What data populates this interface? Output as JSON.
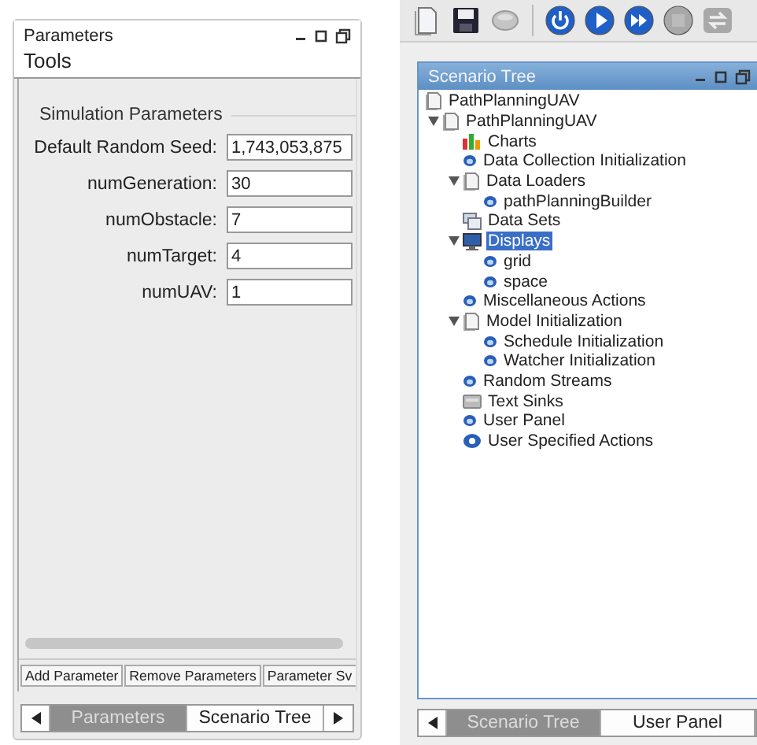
{
  "parameters_panel": {
    "title": "Parameters",
    "subtitle": "Tools",
    "group": {
      "title": "Simulation Parameters",
      "fields": [
        {
          "label": "Default Random Seed:",
          "value": "1,743,053,875"
        },
        {
          "label": "numGeneration:",
          "value": "30"
        },
        {
          "label": "numObstacle:",
          "value": "7"
        },
        {
          "label": "numTarget:",
          "value": "4"
        },
        {
          "label": "numUAV:",
          "value": "1"
        }
      ]
    },
    "buttons": [
      "Add Parameter",
      "Remove Parameters",
      "Parameter Sv"
    ],
    "tabs": [
      {
        "label": "Parameters",
        "selected": true
      },
      {
        "label": "Scenario Tree",
        "selected": false
      }
    ]
  },
  "toolbar": {
    "buttons": [
      {
        "kind": "document",
        "disabled": false
      },
      {
        "kind": "save",
        "disabled": false
      },
      {
        "kind": "database",
        "disabled": true
      },
      {
        "kind": "power",
        "disabled": false
      },
      {
        "kind": "play",
        "disabled": false
      },
      {
        "kind": "fast-forward",
        "disabled": false
      },
      {
        "kind": "stop",
        "disabled": true
      },
      {
        "kind": "swap",
        "disabled": true
      }
    ]
  },
  "scenario_panel": {
    "title": "Scenario Tree",
    "tree": [
      {
        "label": "PathPlanningUAV",
        "kind": "document",
        "selected": false
      },
      {
        "label": "PathPlanningUAV",
        "kind": "document",
        "selected": false,
        "expanded": true,
        "children": [
          {
            "label": "Charts",
            "kind": "chart",
            "selected": false
          },
          {
            "label": "Data Collection Initialization",
            "kind": "action",
            "selected": false
          },
          {
            "label": "Data Loaders",
            "kind": "document",
            "selected": false,
            "expanded": true,
            "children": [
              {
                "label": "pathPlanningBuilder",
                "kind": "action",
                "selected": false
              }
            ]
          },
          {
            "label": "Data Sets",
            "kind": "dataset",
            "selected": false
          },
          {
            "label": "Displays",
            "kind": "display",
            "selected": true,
            "expanded": true,
            "children": [
              {
                "label": "grid",
                "kind": "action",
                "selected": false
              },
              {
                "label": "space",
                "kind": "action",
                "selected": false
              }
            ]
          },
          {
            "label": "Miscellaneous Actions",
            "kind": "action",
            "selected": false
          },
          {
            "label": "Model Initialization",
            "kind": "document",
            "selected": false,
            "expanded": true,
            "children": [
              {
                "label": "Schedule Initialization",
                "kind": "action",
                "selected": false
              },
              {
                "label": "Watcher Initialization",
                "kind": "action",
                "selected": false
              }
            ]
          },
          {
            "label": "Random Streams",
            "kind": "action",
            "selected": false
          },
          {
            "label": "Text Sinks",
            "kind": "sink",
            "selected": false
          },
          {
            "label": "User Panel",
            "kind": "action",
            "selected": false
          },
          {
            "label": "User Specified Actions",
            "kind": "user-action",
            "selected": false
          }
        ]
      }
    ],
    "tabs": [
      {
        "label": "Scenario Tree",
        "selected": true
      },
      {
        "label": "User Panel",
        "selected": false
      }
    ]
  }
}
